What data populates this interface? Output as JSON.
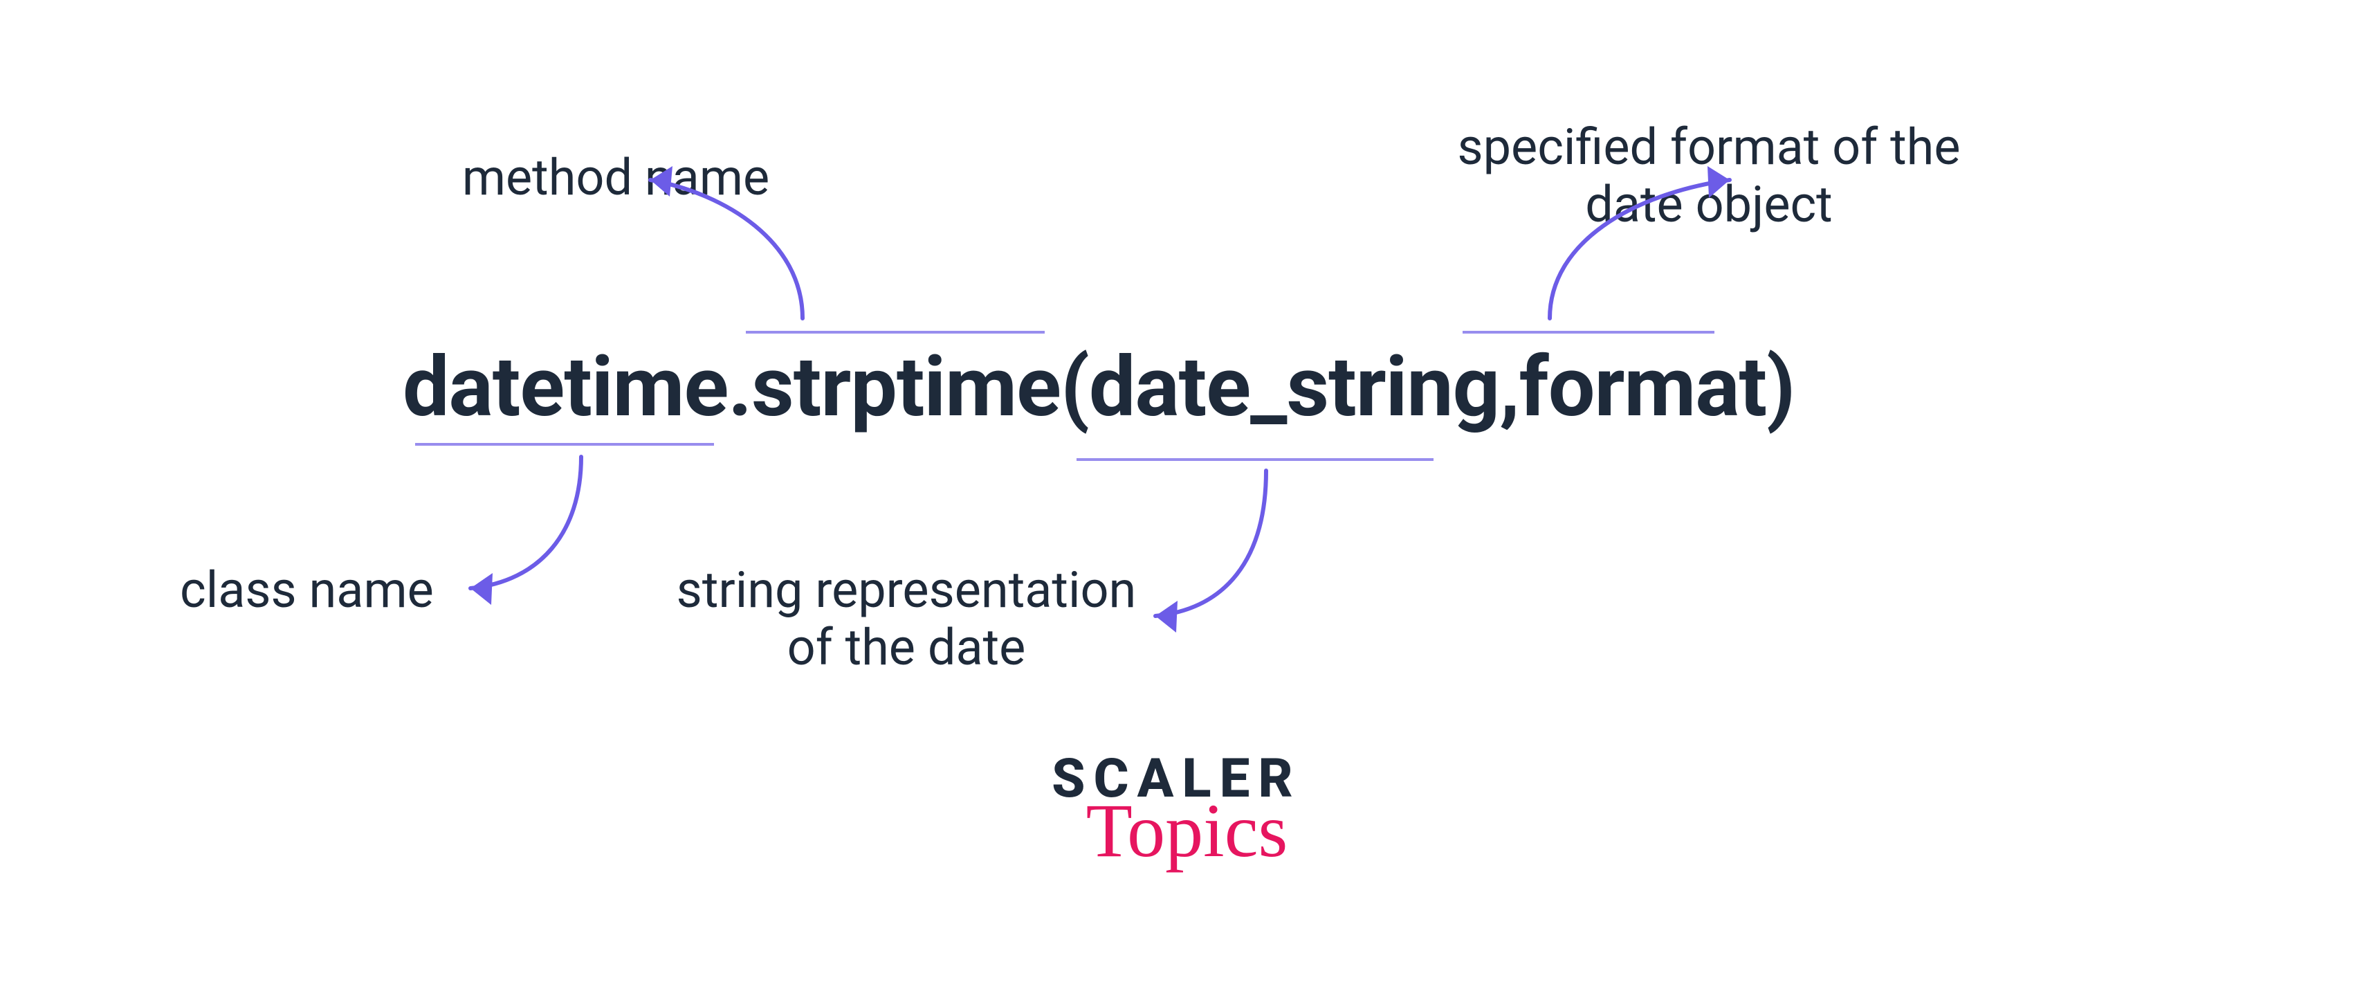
{
  "code": {
    "class_name": "datetime",
    "dot": ".",
    "method_name": "strptime",
    "open_paren": "(",
    "arg1": "date_string",
    "comma": ",",
    "space": " ",
    "arg2": "format",
    "close_paren": ")"
  },
  "annotations": {
    "class_name_label": "class name",
    "method_name_label": "method name",
    "arg1_label_line1": "string representation",
    "arg1_label_line2": "of the date",
    "arg2_label_line1": "specified format of the",
    "arg2_label_line2": "date object"
  },
  "logo": {
    "line1": "SCALER",
    "line2": "Topics"
  },
  "colors": {
    "text": "#1e2a3a",
    "accent": "#6c5ce7",
    "pink": "#e6155f"
  }
}
